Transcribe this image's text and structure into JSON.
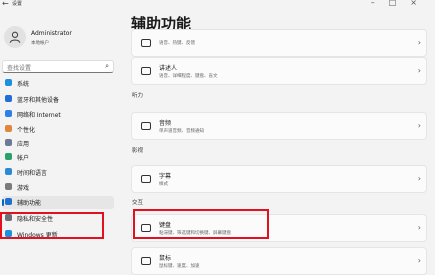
{
  "window": {
    "app_title": "设置",
    "back_glyph": "←",
    "controls_glyphs": "–□×"
  },
  "user": {
    "name": "Administrator",
    "account_type": "本地帐户"
  },
  "search": {
    "placeholder": "查找设置",
    "icon": "search-icon"
  },
  "nav": {
    "items": [
      {
        "label": "系统",
        "icon": "monitor-icon",
        "color": "#1d8fe0"
      },
      {
        "label": "蓝牙和其他设备",
        "icon": "bluetooth-icon",
        "color": "#1f6fd6"
      },
      {
        "label": "网络和 Internet",
        "icon": "wifi-icon",
        "color": "#2f7fe8"
      },
      {
        "label": "个性化",
        "icon": "brush-icon",
        "color": "#e0873a"
      },
      {
        "label": "应用",
        "icon": "apps-icon",
        "color": "#6b7a99"
      },
      {
        "label": "帐户",
        "icon": "person-icon",
        "color": "#2aa06a"
      },
      {
        "label": "时间和语言",
        "icon": "globe-clock-icon",
        "color": "#2a8ad6"
      },
      {
        "label": "游戏",
        "icon": "gamepad-icon",
        "color": "#7a7a7a"
      },
      {
        "label": "辅助功能",
        "icon": "accessibility-icon",
        "color": "#1d6fd1",
        "active": true
      },
      {
        "label": "隐私和安全性",
        "icon": "shield-icon",
        "color": "#6a6f78"
      },
      {
        "label": "Windows 更新",
        "icon": "update-icon",
        "color": "#1d8fe0"
      }
    ]
  },
  "main": {
    "title": "辅助功能",
    "cards": [
      {
        "title": "",
        "subtitle": "语音、热键、反馈",
        "icon": "narrator-icon"
      },
      {
        "title": "讲述人",
        "subtitle": "语音、详细程度、键盘、盲文",
        "icon": "narrator-speaker-icon"
      },
      {
        "title": "音频",
        "subtitle": "单声道音频、音频通知",
        "icon": "speaker-icon"
      },
      {
        "title": "字幕",
        "subtitle": "样式",
        "icon": "captions-icon"
      },
      {
        "title": "键盘",
        "subtitle": "粘滞键、筛选键和切换键、屏幕键盘",
        "icon": "keyboard-icon"
      },
      {
        "title": "鼠标",
        "subtitle": "鼠标键、速度、加速",
        "icon": "mouse-icon"
      }
    ],
    "sections": {
      "hearing": "听力",
      "captions": "影视",
      "interaction": "交互"
    },
    "chevron_glyph": "›"
  },
  "highlight_color": "#e3101f"
}
